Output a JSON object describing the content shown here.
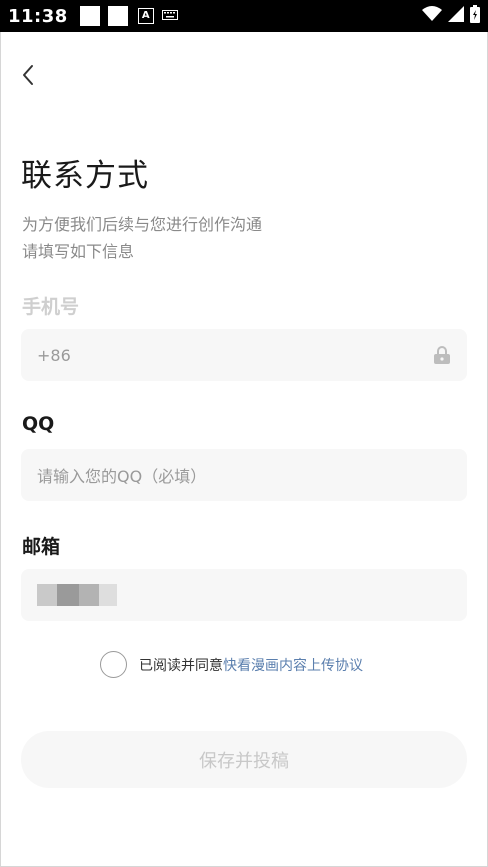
{
  "status_bar": {
    "time": "11:38",
    "notification_icon": "A"
  },
  "header": {
    "back_icon": "chevron-left-icon"
  },
  "page": {
    "title": "联系方式",
    "subtitle_line1": "为方便我们后续与您进行创作沟通",
    "subtitle_line2": "请填写如下信息"
  },
  "phone": {
    "label": "手机号",
    "value": "+86"
  },
  "qq": {
    "label": "QQ",
    "placeholder": "请输入您的QQ（必填）"
  },
  "email": {
    "label": "邮箱"
  },
  "agreement": {
    "text": "已阅读并同意",
    "link": "快看漫画内容上传协议"
  },
  "submit": {
    "label": "保存并投稿"
  },
  "colors": {
    "link": "#5b7fae",
    "field_bg": "#f7f7f7",
    "muted": "#9a9a9a"
  }
}
